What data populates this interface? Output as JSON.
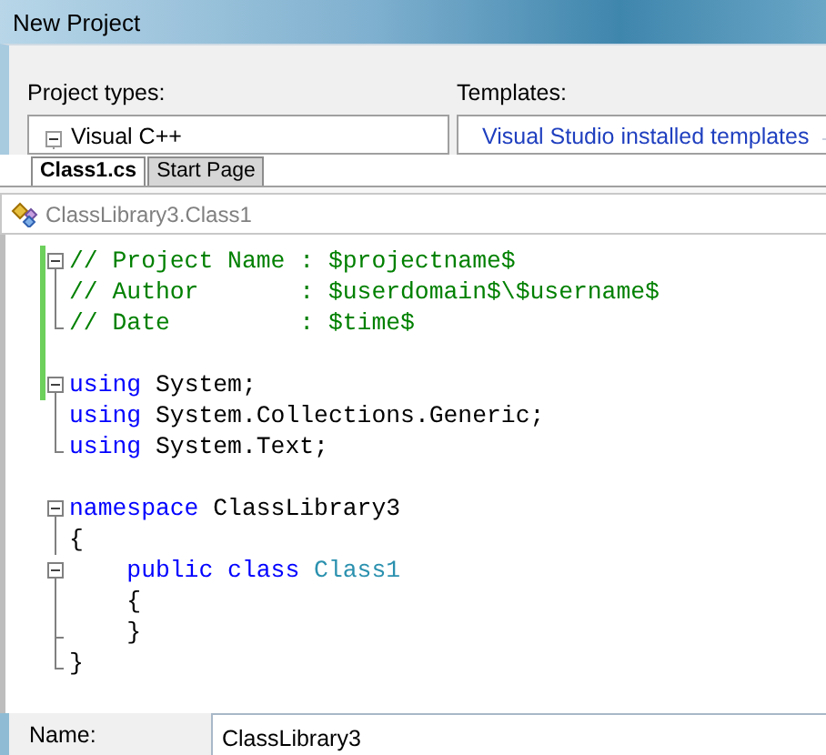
{
  "window": {
    "title": "New Project"
  },
  "project_types": {
    "label": "Project types:",
    "items": [
      {
        "label": "Visual C++",
        "expanded": true
      }
    ]
  },
  "templates": {
    "label": "Templates:",
    "group": "Visual Studio installed templates"
  },
  "editor_tabs": [
    {
      "label": "Class1.cs",
      "selected": true
    },
    {
      "label": "Start Page",
      "selected": false
    }
  ],
  "breadcrumb": "ClassLibrary3.Class1",
  "code_lines": [
    {
      "kind": "start",
      "changed": true,
      "tokens": [
        {
          "kind": "comment",
          "text": "// Project Name : $projectname$"
        }
      ]
    },
    {
      "kind": "mid",
      "changed": true,
      "tokens": [
        {
          "kind": "comment",
          "text": "// Author       : $userdomain$\\$username$"
        }
      ]
    },
    {
      "kind": "end",
      "changed": true,
      "tokens": [
        {
          "kind": "comment",
          "text": "// Date         : $time$"
        }
      ]
    },
    {
      "kind": "blank",
      "changed": true
    },
    {
      "kind": "start",
      "changed": true,
      "tokens": [
        {
          "kind": "keyword",
          "text": "using"
        },
        {
          "kind": "plain",
          "text": " System;"
        }
      ]
    },
    {
      "kind": "mid",
      "changed": false,
      "tokens": [
        {
          "kind": "keyword",
          "text": "using"
        },
        {
          "kind": "plain",
          "text": " System.Collections.Generic;"
        }
      ]
    },
    {
      "kind": "end",
      "changed": false,
      "tokens": [
        {
          "kind": "keyword",
          "text": "using"
        },
        {
          "kind": "plain",
          "text": " System.Text;"
        }
      ]
    },
    {
      "kind": "blank",
      "changed": false
    },
    {
      "kind": "start",
      "changed": false,
      "tokens": [
        {
          "kind": "keyword",
          "text": "namespace"
        },
        {
          "kind": "plain",
          "text": " ClassLibrary3"
        }
      ]
    },
    {
      "kind": "mid",
      "changed": false,
      "tokens": [
        {
          "kind": "plain",
          "text": "{"
        }
      ]
    },
    {
      "kind": "start",
      "changed": false,
      "tokens": [
        {
          "kind": "keyword",
          "text": "    public class"
        },
        {
          "kind": "type",
          "text": " Class1"
        }
      ]
    },
    {
      "kind": "mid",
      "changed": false,
      "tokens": [
        {
          "kind": "plain",
          "text": "    {"
        }
      ]
    },
    {
      "kind": "tick",
      "changed": false,
      "tokens": [
        {
          "kind": "plain",
          "text": "    }"
        }
      ]
    },
    {
      "kind": "end",
      "changed": false,
      "tokens": [
        {
          "kind": "plain",
          "text": "}"
        }
      ]
    }
  ],
  "name_field": {
    "label": "Name:",
    "value": "ClassLibrary3"
  }
}
